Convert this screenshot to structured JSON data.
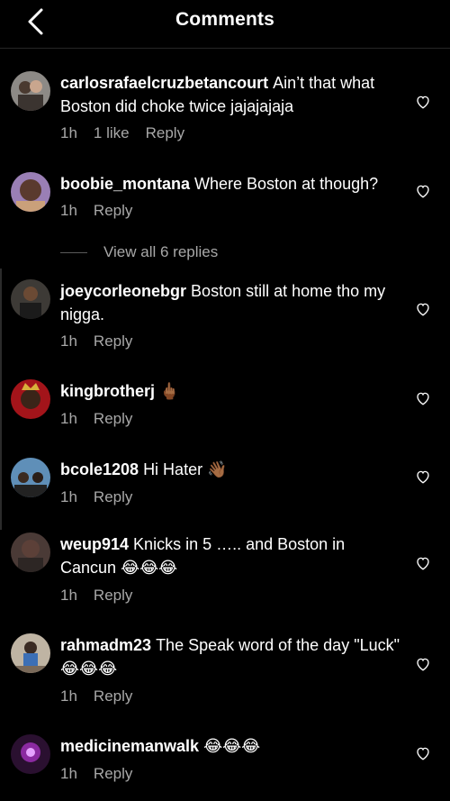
{
  "header": {
    "title": "Comments",
    "back_icon": "chevron-left-icon"
  },
  "view_replies_label": "View all 6 replies",
  "comments": [
    {
      "username": "carlosrafaelcruzbetancourt",
      "text": "Ain’t that what Boston did choke twice jajajajaja",
      "time": "1h",
      "likes": "1 like",
      "reply": "Reply"
    },
    {
      "username": "boobie_montana",
      "text": "Where Boston at though?",
      "time": "1h",
      "reply": "Reply"
    },
    {
      "username": "joeycorleonebgr",
      "text": "Boston still at home tho my nigga.",
      "time": "1h",
      "reply": "Reply"
    },
    {
      "username": "kingbrotherj",
      "text": "",
      "emoji": "🖕🏾",
      "time": "1h",
      "reply": "Reply"
    },
    {
      "username": "bcole1208",
      "text": "Hi Hater",
      "emoji": "👋🏾",
      "time": "1h",
      "reply": "Reply"
    },
    {
      "username": "weup914",
      "text": "Knicks in 5 ….. and Boston in Cancun",
      "emoji": "😂😂😂",
      "time": "1h",
      "reply": "Reply"
    },
    {
      "username": "rahmadm23",
      "text": "The Speak word of the day \"Luck\"",
      "emoji": "😂😂😂",
      "time": "1h",
      "reply": "Reply"
    },
    {
      "username": "medicinemanwalk",
      "text": "",
      "emoji": "😂😂😂",
      "time": "1h",
      "reply": "Reply"
    }
  ],
  "colors": {
    "background": "#000000",
    "text": "#ffffff",
    "secondary": "#a8a8a8"
  }
}
